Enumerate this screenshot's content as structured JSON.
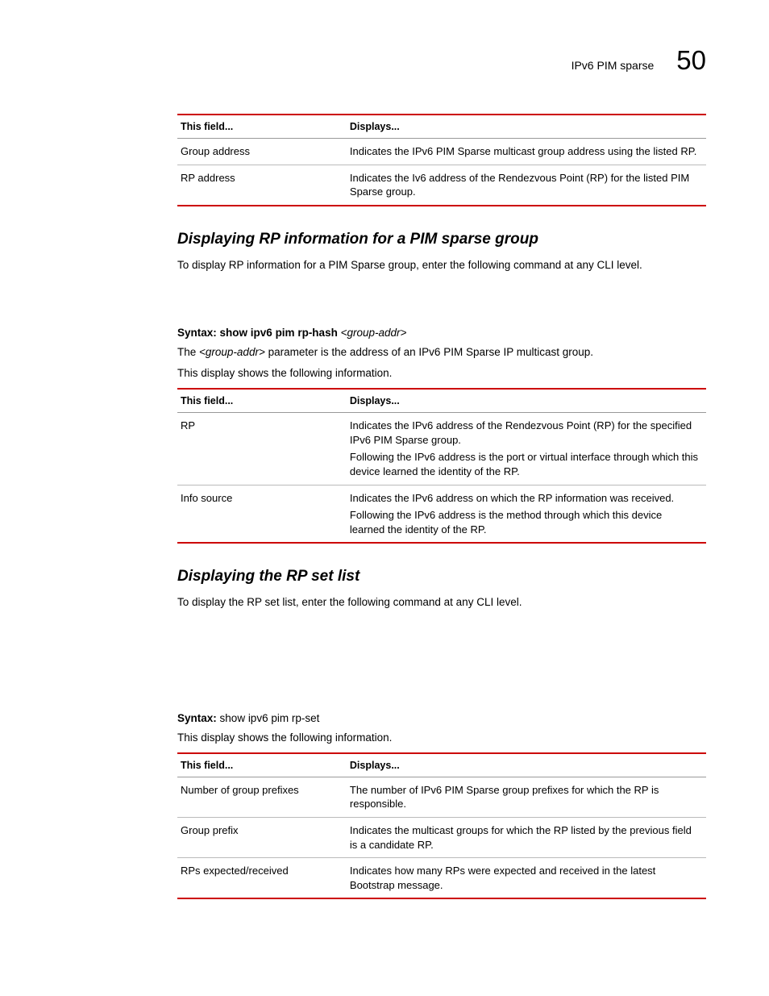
{
  "header": {
    "label": "IPv6 PIM sparse",
    "number": "50"
  },
  "table1": {
    "head_field": "This field...",
    "head_disp": "Displays...",
    "rows": [
      {
        "field": "Group address",
        "disp": "Indicates the IPv6 PIM Sparse multicast group address using the listed RP."
      },
      {
        "field": "RP address",
        "disp": "Indicates the Iv6 address of the Rendezvous Point (RP) for the listed PIM Sparse group."
      }
    ]
  },
  "section1": {
    "title": "Displaying RP information for a PIM sparse group",
    "intro": "To display RP information for a PIM Sparse group, enter the following command at any CLI level.",
    "syntax_label": "Syntax:",
    "syntax_cmd": "show ipv6 pim  rp-hash",
    "syntax_arg": "<group-addr>",
    "param_pre": "The ",
    "param_arg": "<group-addr>",
    "param_post": " parameter is the address of an IPv6 PIM Sparse IP multicast group.",
    "followup": "This display shows the following information."
  },
  "table2": {
    "head_field": "This field...",
    "head_disp": "Displays...",
    "rows": [
      {
        "field": "RP",
        "disp_a": "Indicates the IPv6 address of the Rendezvous Point (RP) for the specified IPv6 PIM Sparse group.",
        "disp_b": "Following the IPv6 address is the port or virtual interface through which this device learned the identity of the RP."
      },
      {
        "field": "Info source",
        "disp_a": "Indicates the IPv6 address on which the RP information was received.",
        "disp_b": "Following the IPv6 address is the method through which this device learned the identity of the RP."
      }
    ]
  },
  "section2": {
    "title": "Displaying the RP set list",
    "intro": "To display the RP set list, enter the following command at any CLI level.",
    "syntax_label": "Syntax:",
    "syntax_cmd": "show ipv6 pim  rp-set",
    "followup": "This display shows the following information."
  },
  "table3": {
    "head_field": "This field...",
    "head_disp": "Displays...",
    "rows": [
      {
        "field": "Number of group prefixes",
        "disp": "The number of IPv6 PIM Sparse group prefixes for which the RP is responsible."
      },
      {
        "field": "Group prefix",
        "disp": "Indicates the multicast groups for which the RP listed by the previous field is a candidate RP."
      },
      {
        "field": "RPs expected/received",
        "disp": "Indicates how many RPs were expected and received in the latest Bootstrap message."
      }
    ]
  }
}
